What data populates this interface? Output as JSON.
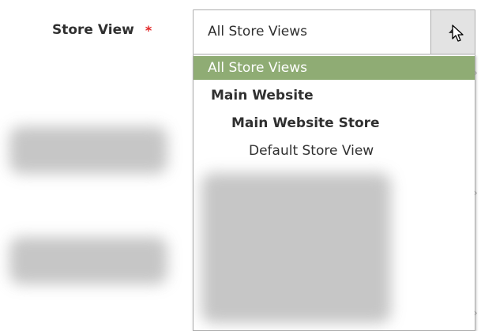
{
  "form": {
    "store_view_label": "Store View",
    "required_marker": "*"
  },
  "select": {
    "current_value": "All Store Views",
    "toggle_icon": "arrow-up-icon",
    "cursor_icon": "pointer-cursor"
  },
  "dropdown": {
    "options": [
      {
        "label": "All Store Views",
        "level": 0,
        "selected": true
      },
      {
        "label": "Main Website",
        "level": 1,
        "selected": false
      },
      {
        "label": "Main Website Store",
        "level": 2,
        "selected": false
      },
      {
        "label": "Default Store View",
        "level": 3,
        "selected": false
      }
    ]
  },
  "colors": {
    "selected_option_bg": "#8fac74",
    "required_marker": "#e22626"
  }
}
